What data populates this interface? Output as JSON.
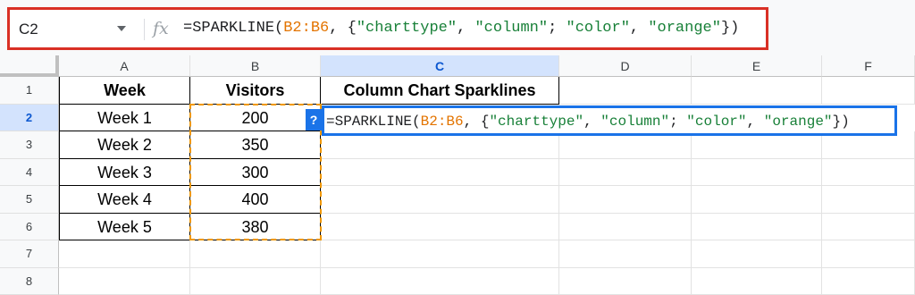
{
  "formula_bar": {
    "name_box": "C2",
    "fx_label": "fx",
    "formula_parts": [
      {
        "text": "=SPARKLINE(",
        "kind": "plain"
      },
      {
        "text": "B2:B6",
        "kind": "range"
      },
      {
        "text": ", {",
        "kind": "plain"
      },
      {
        "text": "\"charttype\"",
        "kind": "str"
      },
      {
        "text": ", ",
        "kind": "plain"
      },
      {
        "text": "\"column\"",
        "kind": "str"
      },
      {
        "text": "; ",
        "kind": "plain"
      },
      {
        "text": "\"color\"",
        "kind": "str"
      },
      {
        "text": ", ",
        "kind": "plain"
      },
      {
        "text": "\"orange\"",
        "kind": "str"
      },
      {
        "text": "})",
        "kind": "plain"
      }
    ]
  },
  "columns": [
    "A",
    "B",
    "C",
    "D",
    "E",
    "F"
  ],
  "rows": [
    "1",
    "2",
    "3",
    "4",
    "5",
    "6",
    "7",
    "8"
  ],
  "selected": {
    "column": "C",
    "row": "2"
  },
  "table": {
    "headers": {
      "A": "Week",
      "B": "Visitors",
      "C": "Column Chart Sparklines"
    },
    "data": [
      {
        "week": "Week 1",
        "visitors": "200"
      },
      {
        "week": "Week 2",
        "visitors": "350"
      },
      {
        "week": "Week 3",
        "visitors": "300"
      },
      {
        "week": "Week 4",
        "visitors": "400"
      },
      {
        "week": "Week 5",
        "visitors": "380"
      }
    ]
  },
  "editor": {
    "help_badge": "?"
  },
  "colors": {
    "range_highlight": "#f29900",
    "active_border": "#1a73e8",
    "callout_border": "#d93025",
    "string_token": "#188038"
  }
}
